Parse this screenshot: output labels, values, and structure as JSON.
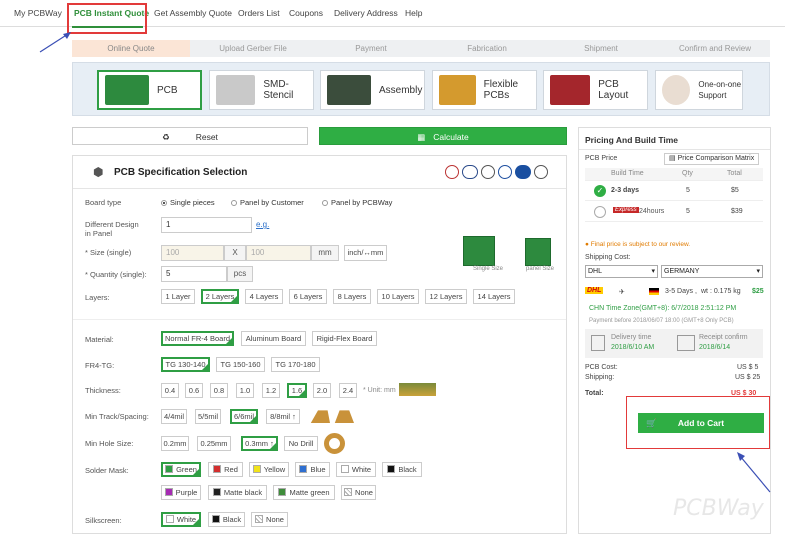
{
  "topnav": {
    "items": [
      "My PCBWay",
      "PCB Instant Quote",
      "Get Assembly Quote",
      "Orders List",
      "Coupons",
      "Delivery Address",
      "Help"
    ]
  },
  "steps": [
    "Online Quote",
    "Upload Gerber File",
    "Payment",
    "Fabrication",
    "Shipment",
    "Confirm and Review"
  ],
  "services": [
    "PCB",
    "SMD-Stencil",
    "Assembly",
    "Flexible PCBs",
    "PCB Layout",
    "One-on-one Support"
  ],
  "actions": {
    "reset": "Reset",
    "calculate": "Calculate"
  },
  "spec": {
    "title": "PCB Specification Selection",
    "board_type": {
      "label": "Board type",
      "options": [
        "Single pieces",
        "Panel by Customer",
        "Panel by PCBWay"
      ],
      "selected": "Single pieces"
    },
    "diff_design": {
      "label": "Different Design in Panel",
      "value": "1",
      "link": "e.g."
    },
    "size": {
      "label": "* Size (single)",
      "x": "100",
      "sep": "X",
      "y": "100",
      "unit": "mm",
      "toggle": "inch/↔mm",
      "fig_single": "Single Size",
      "fig_panel": "panel Size"
    },
    "quantity": {
      "label": "* Quantity (single):",
      "value": "5",
      "unit": "pcs"
    },
    "layers": {
      "label": "Layers:",
      "options": [
        "1 Layer",
        "2 Layers",
        "4 Layers",
        "6 Layers",
        "8 Layers",
        "10 Layers",
        "12 Layers",
        "14 Layers"
      ],
      "selected": "2 Layers"
    },
    "material": {
      "label": "Material:",
      "options": [
        "Normal FR-4 Board",
        "Aluminum Board",
        "Rigid-Flex Board"
      ],
      "selected": "Normal FR-4 Board"
    },
    "fr4tg": {
      "label": "FR4-TG:",
      "options": [
        "TG 130-140",
        "TG 150-160",
        "TG 170-180"
      ],
      "selected": "TG 130-140"
    },
    "thickness": {
      "label": "Thickness:",
      "options": [
        "0.4",
        "0.6",
        "0.8",
        "1.0",
        "1.2",
        "1.6",
        "2.0",
        "2.4"
      ],
      "selected": "1.6",
      "unit_note": "* Unit: mm"
    },
    "track": {
      "label": "Min Track/Spacing:",
      "options": [
        "4/4mil",
        "5/5mil",
        "6/6mil",
        "8/8mil ↑"
      ],
      "selected": "6/6mil"
    },
    "hole": {
      "label": "Min Hole Size:",
      "options": [
        "0.2mm",
        "0.25mm",
        "0.3mm ↑",
        "No Drill"
      ],
      "selected": "0.3mm ↑"
    },
    "mask": {
      "label": "Solder Mask:",
      "options": [
        "Green",
        "Red",
        "Yellow",
        "Blue",
        "White",
        "Black",
        "Purple",
        "Matte black",
        "Matte green",
        "None"
      ],
      "selected": "Green"
    },
    "silk": {
      "label": "Silkscreen:",
      "options": [
        "White",
        "Black",
        "None"
      ],
      "selected": "White"
    }
  },
  "side": {
    "title": "Pricing And Build Time",
    "pcb_price": "PCB Price",
    "matrix": "Price Comparison Matrix",
    "cols": [
      "Build Time",
      "Qty",
      "Total"
    ],
    "rows": [
      {
        "time": "2-3 days",
        "qty": "5",
        "total": "$5"
      },
      {
        "badge": "Express",
        "time": "24hours",
        "qty": "5",
        "total": "$39"
      }
    ],
    "final_note": "Final price is subject to our review.",
    "shipping_cost": "Shipping Cost:",
    "carrier": "DHL",
    "country": "GERMANY",
    "dhl_logo": "DHL",
    "ship_days": "3-5 Days ,",
    "ship_weight": "wt : 0.175 kg",
    "ship_price": "$25",
    "tz": "CHN Time Zone(GMT+8): 6/7/2018 2:51:12 PM",
    "pay_before": "Payment before 2018/06/07 18:00 (GMT+8 Only PCB)",
    "delivery_label": "Delivery time",
    "delivery_date": "2018/6/10 AM",
    "receipt_label": "Receipt confirm",
    "receipt_date": "2018/6/14",
    "pcb_cost_label": "PCB Cost:",
    "pcb_cost": "US $ 5",
    "shipping_label": "Shipping:",
    "shipping": "US $ 25",
    "total_label": "Total:",
    "total": "US $ 30",
    "cart": "Add to Cart"
  },
  "watermark": "PCBWay"
}
